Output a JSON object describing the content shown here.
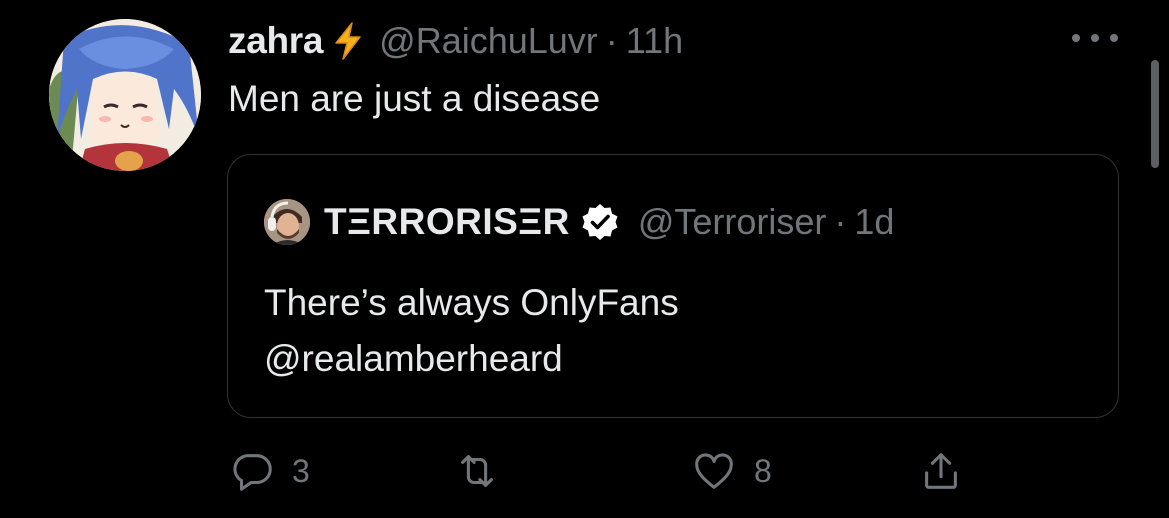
{
  "tweet": {
    "author": {
      "display_name": "zahra",
      "emoji": "⚡",
      "handle": "@RaichuLuvr",
      "separator": "·",
      "time": "11h",
      "avatar_icon": "anime-avatar"
    },
    "text": "Men are just a disease",
    "more_icon": "ellipsis-icon"
  },
  "quoted_tweet": {
    "author": {
      "display_name": "TΞRRORISΞR",
      "verified": true,
      "handle": "@Terroriser",
      "separator": "·",
      "time": "1d",
      "avatar_icon": "user-photo-avatar"
    },
    "text_lines": [
      "There’s always OnlyFans",
      "@realamberheard"
    ]
  },
  "actions": {
    "reply": {
      "icon": "reply-icon",
      "count": "3"
    },
    "retweet": {
      "icon": "retweet-icon",
      "count": ""
    },
    "like": {
      "icon": "heart-icon",
      "count": "8"
    },
    "share": {
      "icon": "share-icon",
      "count": ""
    }
  },
  "colors": {
    "background": "#000000",
    "primary_text": "#e7e9ea",
    "secondary_text": "#71767b",
    "border": "#2f3336",
    "verified_badge": "#ffffff",
    "bolt": "#f7b21b"
  }
}
